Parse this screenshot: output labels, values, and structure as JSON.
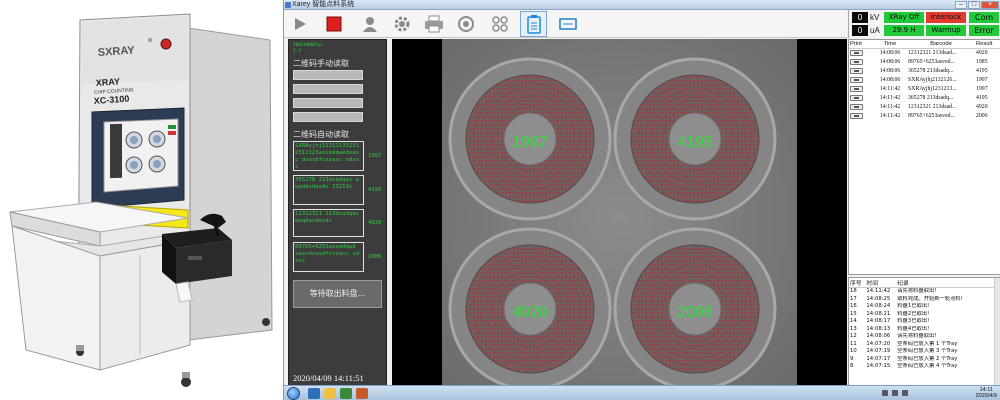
{
  "photo": {
    "brand": "SXRAY",
    "label_line1": "XRAY",
    "label_line2": "CHIP COUNTING",
    "label_line3": "XC-3100"
  },
  "window": {
    "title": "Xarey 智能点料系统"
  },
  "toolbar": {
    "buttons": [
      "play-icon",
      "stop-icon",
      "user-icon",
      "gear-icon",
      "printer-icon",
      "disc-icon",
      "grid-icon",
      "clipboard-icon",
      "expand-icon"
    ]
  },
  "status": {
    "kv_value": "0",
    "kv_unit": "kV",
    "ua_value": "0",
    "ua_unit": "uA",
    "xray_off": "XRay Off",
    "interlock": "Interlock",
    "com": "Com",
    "com_error": "Error",
    "warmup_time": "29.9 H",
    "warmup": "Warmup",
    "colors": {
      "green": "#22c93a",
      "red": "#e23a2e"
    }
  },
  "control": {
    "top_code_line1": "3601h0007pc",
    "top_code_line2": "1-2",
    "manual_title": "二维码手动读取",
    "auto_title": "二维码自动读取",
    "auto_reads": [
      {
        "text": "SXRAyjhj12312131231 2312123asvedqwedxasc dxasdfcxzasc xdzsc",
        "count": "1997"
      },
      {
        "text": "365278 213dsadqas ewqdasdasdv 23213c",
        "count": "4195"
      },
      {
        "text": "12312321 213dsadqas ewqdasdasdv",
        "count": "4920"
      },
      {
        "text": "89765+6253asvedqwd xascdxasdfcxzasc xdzsc",
        "count": "2006"
      }
    ],
    "wait_button": "等待取出料盘...",
    "datetime": "2020/04/09 14:11:51"
  },
  "xray": {
    "counts": [
      "1997",
      "4195",
      "4920",
      "2006"
    ]
  },
  "print_table": {
    "headers": [
      "Print",
      "Time",
      "Barcode",
      "Result"
    ],
    "rows": [
      [
        "14:08:06",
        "12312321 213dsad...",
        "4920"
      ],
      [
        "14:08:06",
        "89765+6253asved...",
        "1985"
      ],
      [
        "14:08:06",
        "365278 213dsadq...",
        "4195"
      ],
      [
        "14:08:06",
        "SXRAyjhj2132126...",
        "1997"
      ],
      [
        "14:11:42",
        "SXRAyjhj1231213...",
        "1997"
      ],
      [
        "14:11:42",
        "365278 213dsadq...",
        "4195"
      ],
      [
        "14:11:42",
        "12312321 213dsad...",
        "4920"
      ],
      [
        "14:11:42",
        "89765+6253asved...",
        "2006"
      ]
    ]
  },
  "log_table": {
    "headers": [
      "序号",
      "时间",
      "纪录"
    ],
    "rows": [
      [
        "18",
        "14:11:42",
        "请先将料盘取出!"
      ],
      [
        "17",
        "14:08:25",
        "取料完成。开始新一轮点料!"
      ],
      [
        "16",
        "14:08:24",
        "料盘1已取出!"
      ],
      [
        "15",
        "14:08:21",
        "料盘2已取出!"
      ],
      [
        "14",
        "14:08:17",
        "料盘3已取出!"
      ],
      [
        "13",
        "14:08:13",
        "料盘4已取出!"
      ],
      [
        "12",
        "14:08:06",
        "请先将料盘取出!"
      ],
      [
        "11",
        "14:07:20",
        "空条码已放入第 1 个Tray"
      ],
      [
        "10",
        "14:07:19",
        "空条码已放入第 3 个Tray"
      ],
      [
        "9",
        "14:07:17",
        "空条码已放入第 2 个Tray"
      ],
      [
        "8",
        "14:07:15",
        "空条码已放入第 4 个Tray"
      ]
    ]
  },
  "taskbar": {
    "time": "14:11",
    "date": "2020/4/9"
  }
}
